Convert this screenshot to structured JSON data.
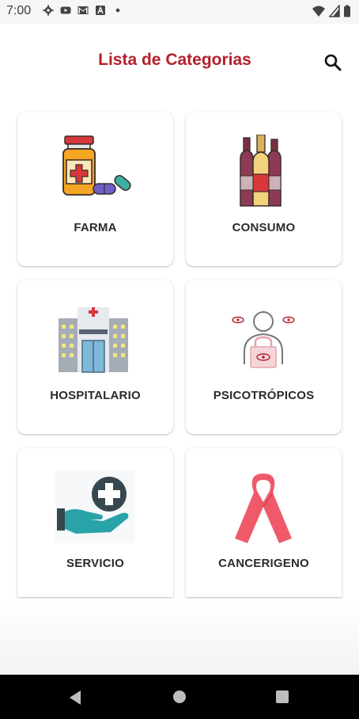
{
  "status_bar": {
    "time": "7:00",
    "left_icons": [
      "gear-icon",
      "youtube-icon",
      "gmail-icon",
      "app-a-icon",
      "dot-icon"
    ],
    "right_icons": [
      "wifi-icon",
      "signal-icon",
      "battery-icon"
    ]
  },
  "header": {
    "title": "Lista de Categorias",
    "title_color": "#b3202a",
    "search_icon": "search-icon"
  },
  "categories": [
    {
      "label": "FARMA",
      "icon": "medicine-bottle-icon"
    },
    {
      "label": "CONSUMO",
      "icon": "bottles-icon"
    },
    {
      "label": "HOSPITALARIO",
      "icon": "hospital-building-icon"
    },
    {
      "label": "PSICOTRÓPICOS",
      "icon": "person-lock-eye-icon"
    },
    {
      "label": "SERVICIO",
      "icon": "hand-plus-icon"
    },
    {
      "label": "CANCERIGENO",
      "icon": "awareness-ribbon-icon"
    }
  ],
  "nav_bar": {
    "icons": [
      "back-icon",
      "home-icon",
      "recent-apps-icon"
    ]
  }
}
